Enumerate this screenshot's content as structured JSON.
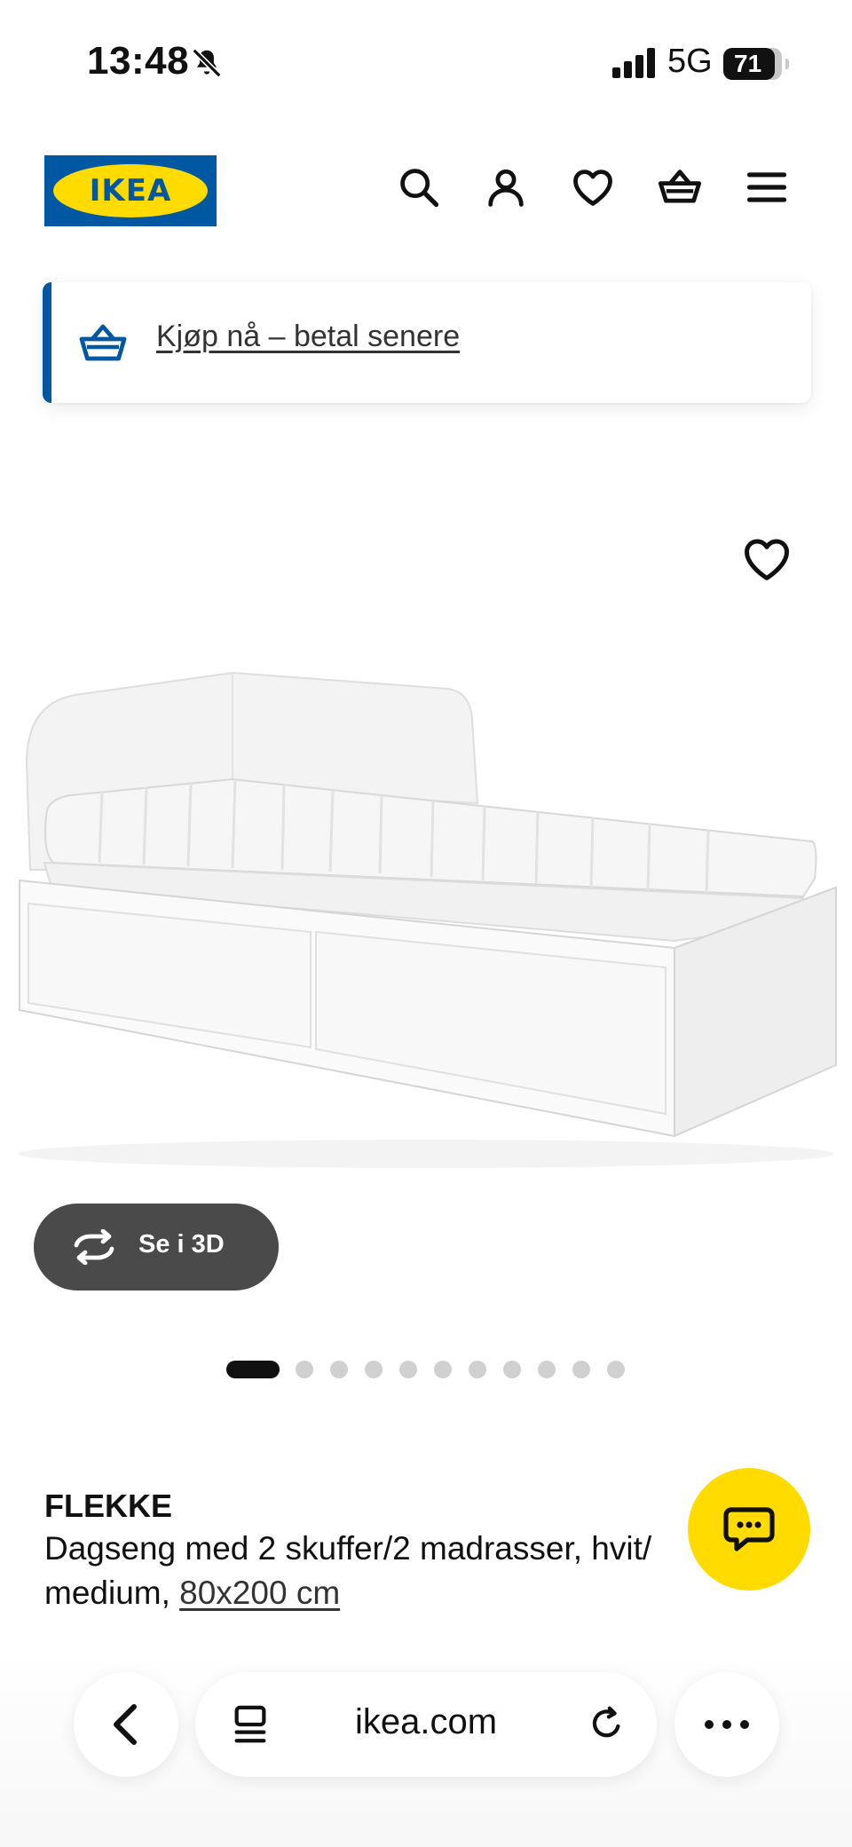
{
  "status_bar": {
    "time": "13:48",
    "network": "5G",
    "battery": "71"
  },
  "header": {
    "logo_text": "IKEA",
    "icons": [
      "search-icon",
      "user-icon",
      "heart-icon",
      "basket-icon",
      "menu-icon"
    ]
  },
  "banner": {
    "text": "Kjøp nå – betal senere",
    "accent_color": "#0058a3"
  },
  "product": {
    "view_3d_label": "Se i 3D",
    "image_count": 12,
    "active_image": 1,
    "name": "FLEKKE",
    "description_line1": "Dagseng med 2 skuffer/2 madrasser, hvit/",
    "description_line2_prefix": "medium, ",
    "size_link": "80x200 cm"
  },
  "browser": {
    "url": "ikea.com"
  },
  "colors": {
    "brand_blue": "#0058a3",
    "brand_yellow": "#ffdb00",
    "dark_button": "#4a4a4a"
  }
}
